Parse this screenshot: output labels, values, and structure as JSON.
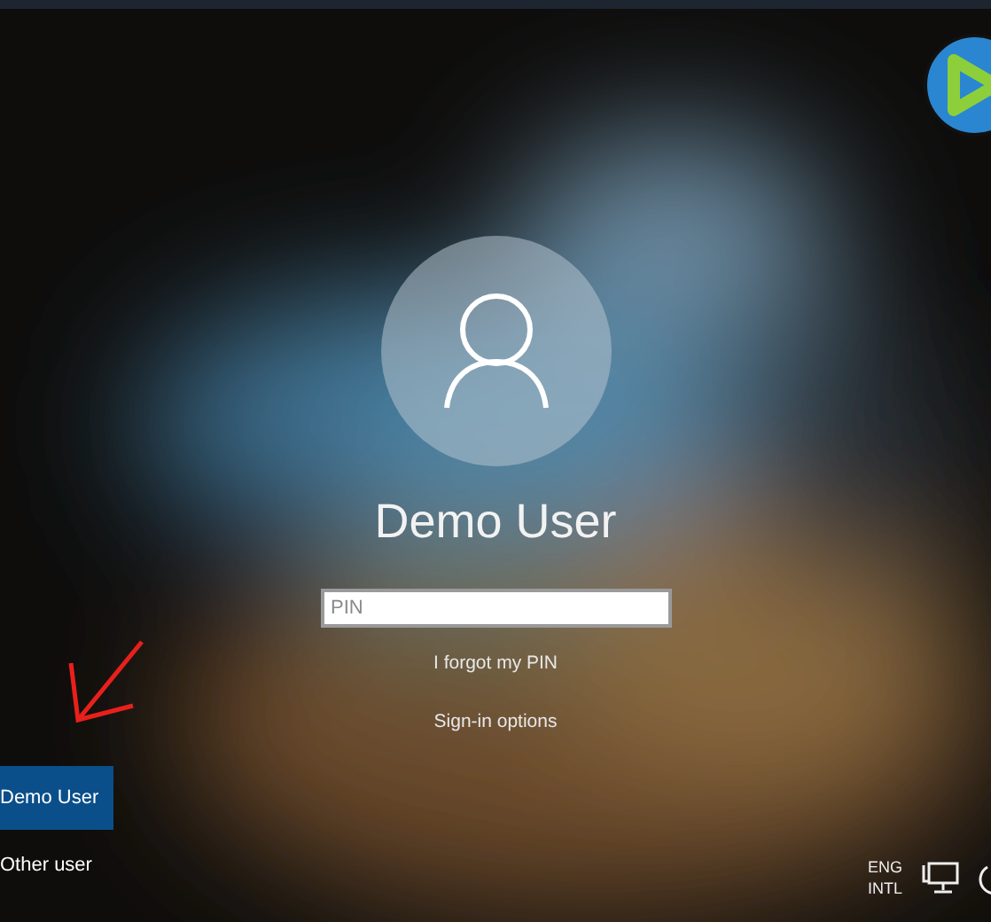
{
  "account": {
    "name": "Demo User"
  },
  "pin_field": {
    "placeholder": "PIN"
  },
  "links": [
    "I forgot my PIN",
    "Sign-in options"
  ],
  "users": [
    {
      "name": "Demo User",
      "selected": true
    },
    {
      "name": "Other user",
      "selected": false
    }
  ],
  "tray": {
    "language": "ENG",
    "layout": "INTL"
  }
}
